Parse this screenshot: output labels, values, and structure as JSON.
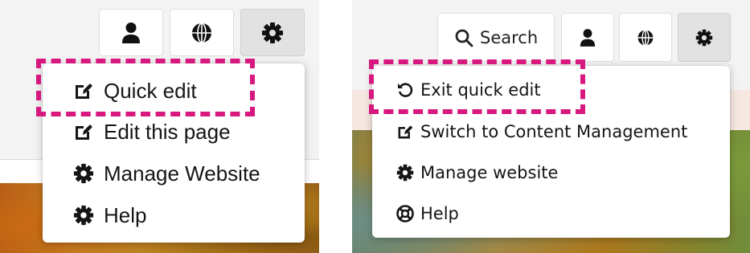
{
  "left_panel": {
    "toolbar": {
      "user_icon": "user-icon",
      "globe_icon": "globe-icon",
      "settings_icon": "gear-icon"
    },
    "menu": {
      "items": [
        {
          "label": "Quick edit",
          "icon": "edit-icon"
        },
        {
          "label": "Edit this page",
          "icon": "edit-icon"
        },
        {
          "label": "Manage Website",
          "icon": "gear-icon"
        },
        {
          "label": "Help",
          "icon": "gear-icon"
        }
      ]
    }
  },
  "right_panel": {
    "toolbar": {
      "search_label": "Search",
      "search_icon": "search-icon",
      "user_icon": "user-icon",
      "globe_icon": "globe-icon",
      "settings_icon": "gear-icon"
    },
    "menu": {
      "items": [
        {
          "label": "Exit quick edit",
          "icon": "undo-icon"
        },
        {
          "label": "Switch to Content Management",
          "icon": "edit-icon"
        },
        {
          "label": "Manage website",
          "icon": "gear-icon"
        },
        {
          "label": "Help",
          "icon": "lifebuoy-icon"
        }
      ]
    }
  },
  "colors": {
    "highlight": "#d6187f",
    "active_button": "#e2e2e2"
  }
}
